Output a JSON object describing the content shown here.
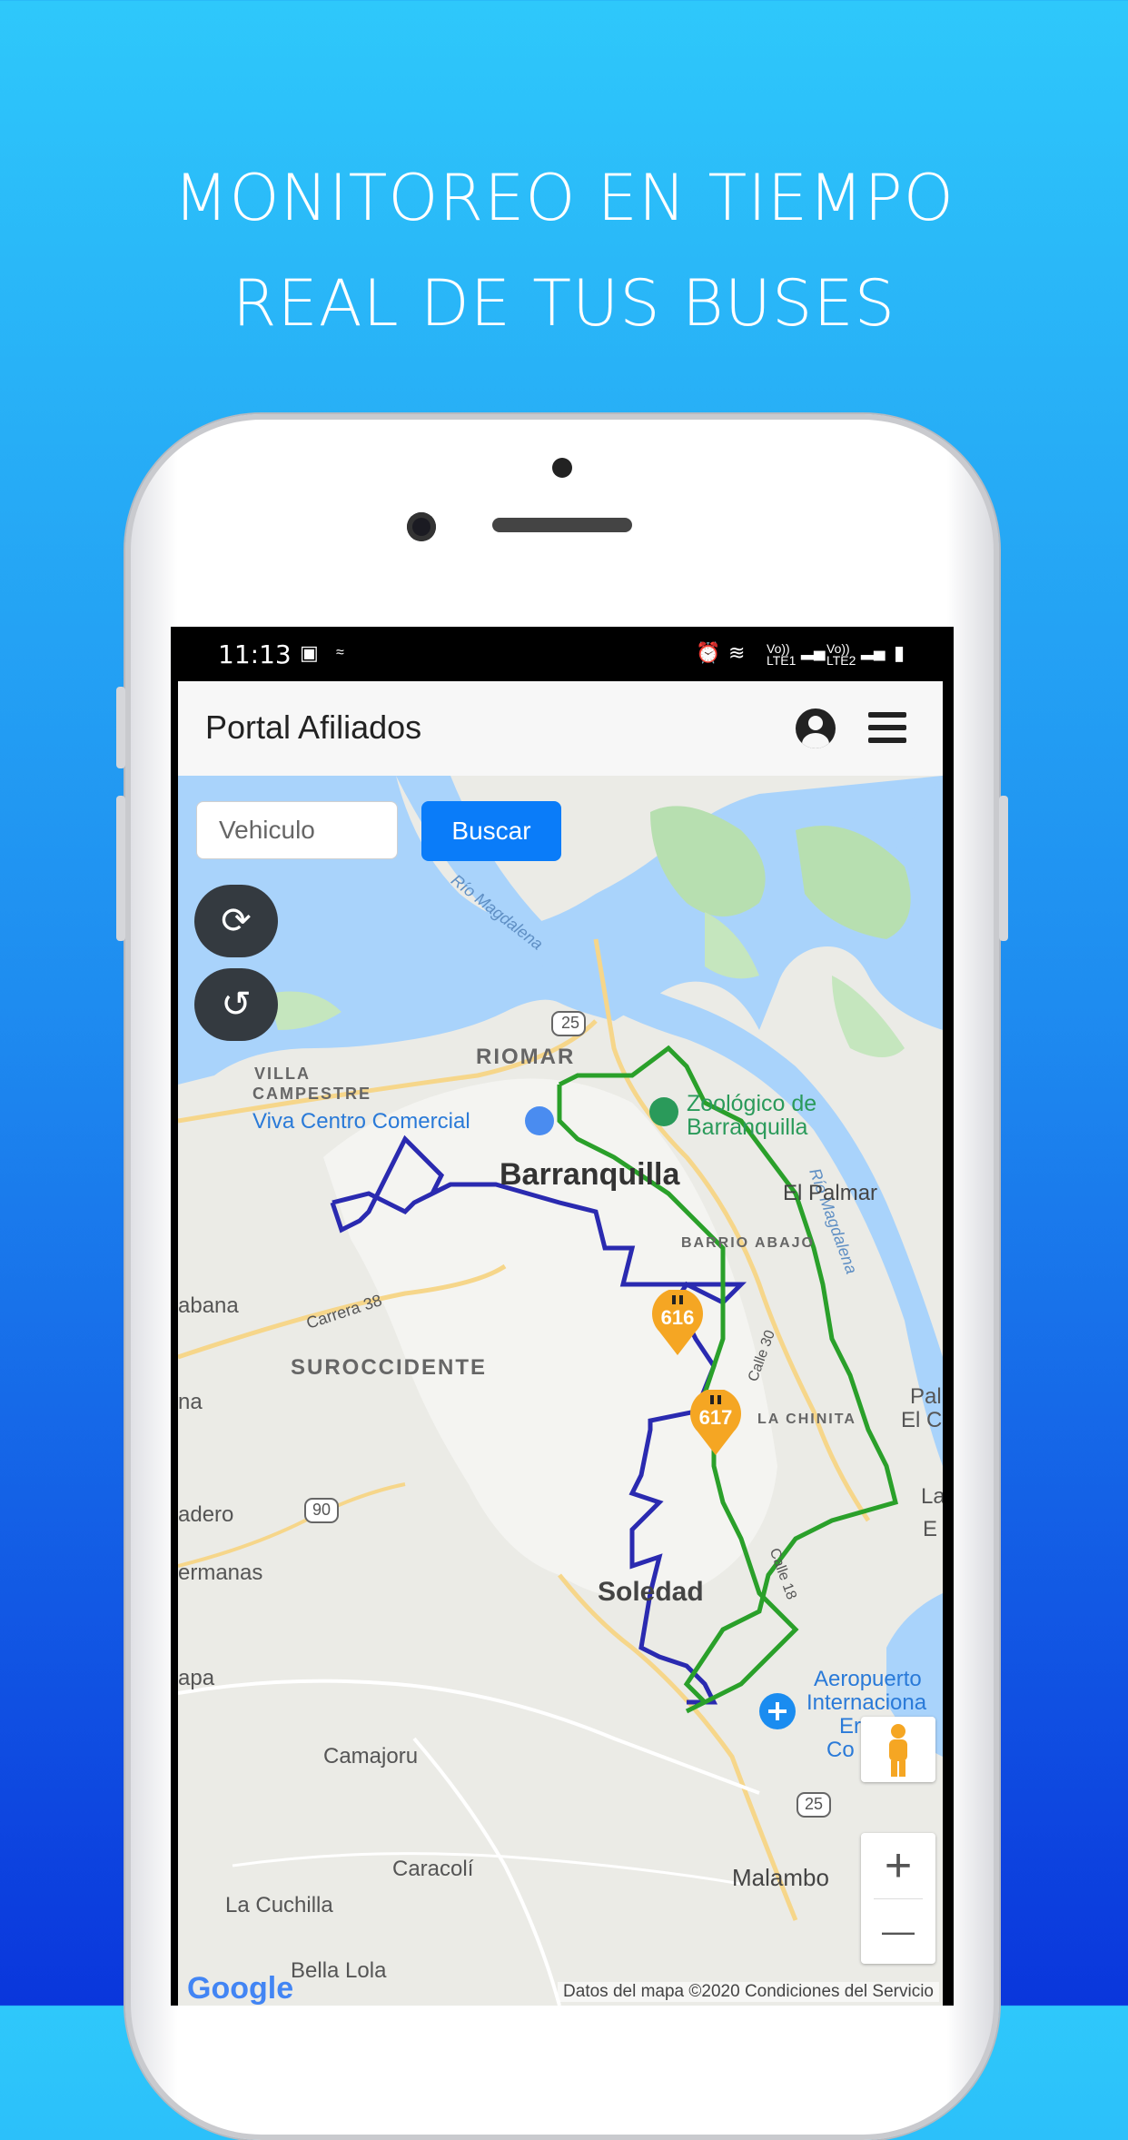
{
  "headline": {
    "line1": "MONITOREO EN TIEMPO",
    "line2": "REAL DE TUS BUSES"
  },
  "statusbar": {
    "time": "11:13",
    "lte1": "LTE1",
    "lte2": "LTE2",
    "volte1": "Vo))",
    "volte2": "Vo))"
  },
  "appbar": {
    "title": "Portal Afiliados",
    "icons": [
      "user-circle-icon",
      "hamburger-menu-icon"
    ]
  },
  "search": {
    "placeholder": "Vehiculo",
    "button_label": "Buscar"
  },
  "map_buttons": [
    "refresh-icon",
    "history-icon"
  ],
  "markers": [
    {
      "label": "616",
      "color": "#f5a623"
    },
    {
      "label": "617",
      "color": "#f5a623"
    }
  ],
  "routes": [
    {
      "color": "#2a2ab0"
    },
    {
      "color": "#2aa02a"
    }
  ],
  "map_labels": {
    "riomar": "RIOMAR",
    "villa_campestre_1": "VILLA",
    "villa_campestre_2": "CAMPESTRE",
    "viva": "Viva Centro Comercial",
    "zoo_1": "Zoológico de",
    "zoo_2": "Barranquilla",
    "barranquilla": "Barranquilla",
    "el_palmar": "El Palmar",
    "barrio_abajo": "BARRIO ABAJO",
    "galapa": "abana",
    "carrera38": "Carrera 38",
    "suroccidente": "SUROCCIDENTE",
    "na": "na",
    "la_chinita": "LA CHINITA",
    "pal": "Pal",
    "el_c": "El C",
    "aldero": "adero",
    "hermanas": "ermanas",
    "soledad": "Soledad",
    "apa": "apa",
    "aeropuerto_1": "Aeropuerto",
    "aeropuerto_2": "Internaciona",
    "aeropuerto_3": "Er",
    "aeropuerto_4": "Co",
    "camajoru": "Camajoru",
    "caracoli": "Caracolí",
    "malambo": "Malambo",
    "la_cuchilla": "La Cuchilla",
    "bella_lola": "Bella Lola",
    "rio_magdalena_1": "Río Magdalena",
    "rio_magdalena_2": "Río Magdalena",
    "calle30": "Calle 30",
    "calle18": "Calle 18",
    "la": "La",
    "e": "E",
    "r25_top": "25",
    "r90": "90",
    "r25_bottom": "25"
  },
  "map_controls": {
    "zoom_in": "+",
    "zoom_out": "—"
  },
  "attribution": {
    "google": "Google",
    "copyright": "Datos del mapa ©2020   Condiciones del Servicio"
  }
}
